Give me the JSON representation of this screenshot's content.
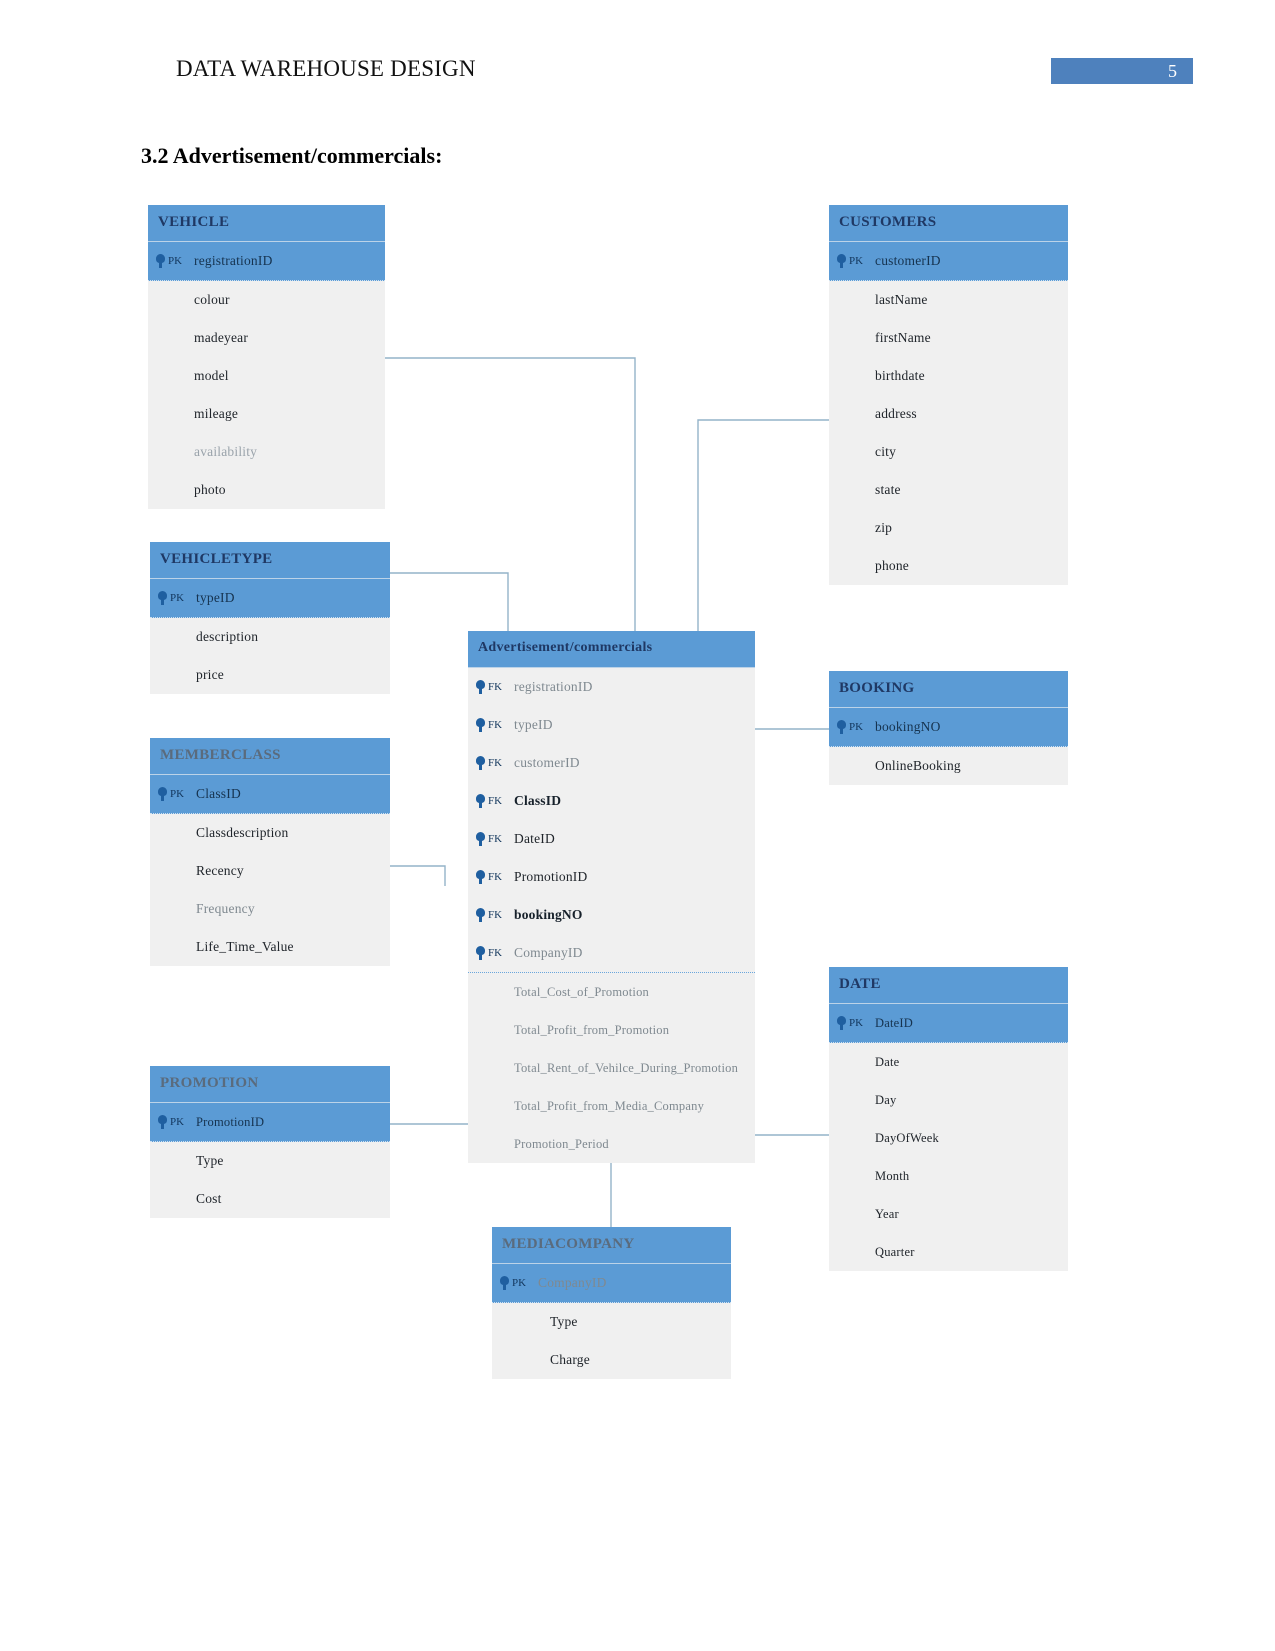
{
  "header": {
    "document_title": "DATA WAREHOUSE DESIGN",
    "page_number": "5",
    "accent_color": "#4e81bd"
  },
  "section": {
    "heading": "3.2 Advertisement/commercials:"
  },
  "diagram": {
    "type": "entity-relationship-diagram",
    "header_color": "#5b9bd5",
    "body_color": "#f0f0f0",
    "connector_color": "#94b3c9",
    "entities": [
      {
        "name": "VEHICLE",
        "pk": {
          "key": "PK",
          "field": "registrationID"
        },
        "fields": [
          "colour",
          "madeyear",
          "model",
          "mileage",
          "availability",
          "photo"
        ]
      },
      {
        "name": "CUSTOMERS",
        "pk": {
          "key": "PK",
          "field": "customerID"
        },
        "fields": [
          "lastName",
          "firstName",
          "birthdate",
          "address",
          "city",
          "state",
          "zip",
          "phone"
        ]
      },
      {
        "name": "VEHICLETYPE",
        "pk": {
          "key": "PK",
          "field": "typeID"
        },
        "fields": [
          "description",
          "price"
        ]
      },
      {
        "name": "MEMBERCLASS",
        "pk": {
          "key": "PK",
          "field": "ClassID"
        },
        "fields": [
          "Classdescription",
          "Recency",
          "Frequency",
          "Life_Time_Value"
        ]
      },
      {
        "name": "PROMOTION",
        "pk": {
          "key": "PK",
          "field": "PromotionID"
        },
        "fields": [
          "Type",
          "Cost"
        ]
      },
      {
        "name": "BOOKING",
        "pk": {
          "key": "PK",
          "field": "bookingNO"
        },
        "fields": [
          "OnlineBooking"
        ]
      },
      {
        "name": "DATE",
        "pk": {
          "key": "PK",
          "field": "DateID"
        },
        "fields": [
          "Date",
          "Day",
          "DayOfWeek",
          "Month",
          "Year",
          "Quarter"
        ]
      },
      {
        "name": "MEDIACOMPANY",
        "pk": {
          "key": "PK",
          "field": "CompanyID"
        },
        "fields": [
          "Type",
          "Charge"
        ]
      }
    ],
    "fact_table": {
      "name": "Advertisement/commercials",
      "foreign_keys": [
        {
          "key": "FK",
          "field": "registrationID"
        },
        {
          "key": "FK",
          "field": "typeID"
        },
        {
          "key": "FK",
          "field": "customerID"
        },
        {
          "key": "FK",
          "field": "ClassID"
        },
        {
          "key": "FK",
          "field": "DateID"
        },
        {
          "key": "FK",
          "field": "PromotionID"
        },
        {
          "key": "FK",
          "field": "bookingNO"
        },
        {
          "key": "FK",
          "field": "CompanyID"
        }
      ],
      "measures": [
        "Total_Cost_of_Promotion",
        "Total_Profit_from_Promotion",
        "Total_Rent_of_Vehilce_During_Promotion",
        "Total_Profit_from_Media_Company",
        "Promotion_Period"
      ]
    }
  }
}
